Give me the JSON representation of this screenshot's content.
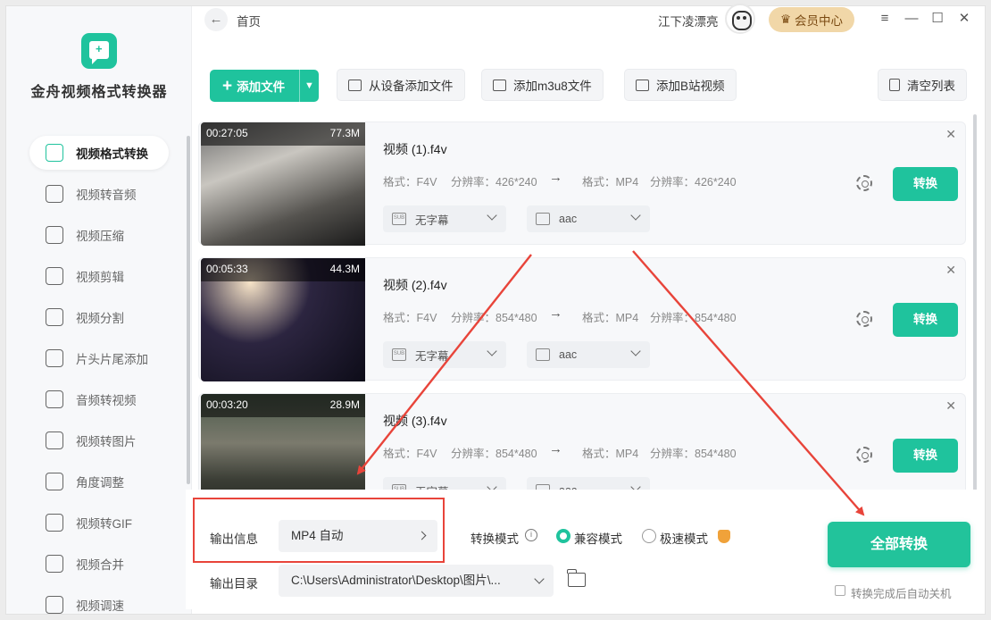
{
  "app": {
    "title": "金舟视频格式转换器",
    "breadcrumb": "首页",
    "username": "江下凌漂亮",
    "vip_label": "会员中心",
    "window_controls": {
      "menu": "≡",
      "minimize": "—",
      "maximize": "☐",
      "close": "✕"
    }
  },
  "sidebar": {
    "items": [
      {
        "label": "视频格式转换",
        "icon": "convert-icon",
        "active": true
      },
      {
        "label": "视频转音频",
        "icon": "music-note-icon",
        "active": false
      },
      {
        "label": "视频压缩",
        "icon": "compress-icon",
        "active": false
      },
      {
        "label": "视频剪辑",
        "icon": "scissors-icon",
        "active": false
      },
      {
        "label": "视频分割",
        "icon": "split-icon",
        "active": false
      },
      {
        "label": "片头片尾添加",
        "icon": "film-strip-icon",
        "active": false
      },
      {
        "label": "音频转视频",
        "icon": "audio-disc-icon",
        "active": false
      },
      {
        "label": "视频转图片",
        "icon": "image-icon",
        "active": false
      },
      {
        "label": "角度调整",
        "icon": "rotate-icon",
        "active": false
      },
      {
        "label": "视频转GIF",
        "icon": "gif-icon",
        "active": false
      },
      {
        "label": "视频合并",
        "icon": "merge-icon",
        "active": false
      },
      {
        "label": "视频调速",
        "icon": "speed-icon",
        "active": false
      }
    ]
  },
  "toolbar": {
    "add_file": "添加文件",
    "add_from_device": "从设备添加文件",
    "add_m3u8": "添加m3u8文件",
    "add_bilibili": "添加B站视频",
    "clear_list": "清空列表"
  },
  "files": [
    {
      "name": "视频 (1).f4v",
      "duration": "00:27:05",
      "size": "77.3M",
      "src_format_label": "格式：F4V",
      "src_res_label": "分辨率：426*240",
      "dst_format_label": "格式：MP4",
      "dst_res_label": "分辨率：426*240",
      "subtitle": "无字幕",
      "audio": "aac",
      "convert_label": "转换"
    },
    {
      "name": "视频 (2).f4v",
      "duration": "00:05:33",
      "size": "44.3M",
      "src_format_label": "格式：F4V",
      "src_res_label": "分辨率：854*480",
      "dst_format_label": "格式：MP4",
      "dst_res_label": "分辨率：854*480",
      "subtitle": "无字幕",
      "audio": "aac",
      "convert_label": "转换"
    },
    {
      "name": "视频 (3).f4v",
      "duration": "00:03:20",
      "size": "28.9M",
      "src_format_label": "格式：F4V",
      "src_res_label": "分辨率：854*480",
      "dst_format_label": "格式：MP4",
      "dst_res_label": "分辨率：854*480",
      "subtitle": "无字幕",
      "audio": "aac",
      "convert_label": "转换"
    }
  ],
  "bottom": {
    "output_info_label": "输出信息",
    "output_format": "MP4 自动",
    "output_dir_label": "输出目录",
    "output_dir": "C:\\Users\\Administrator\\Desktop\\图片\\...",
    "mode_label": "转换模式",
    "mode_compat": "兼容模式",
    "mode_fast": "极速模式",
    "convert_all": "全部转换",
    "auto_shutdown": "转换完成后自动关机"
  },
  "colors": {
    "accent": "#1fc39d",
    "vip_bg": "#f1d7a8",
    "annotation_red": "#e8443a"
  }
}
